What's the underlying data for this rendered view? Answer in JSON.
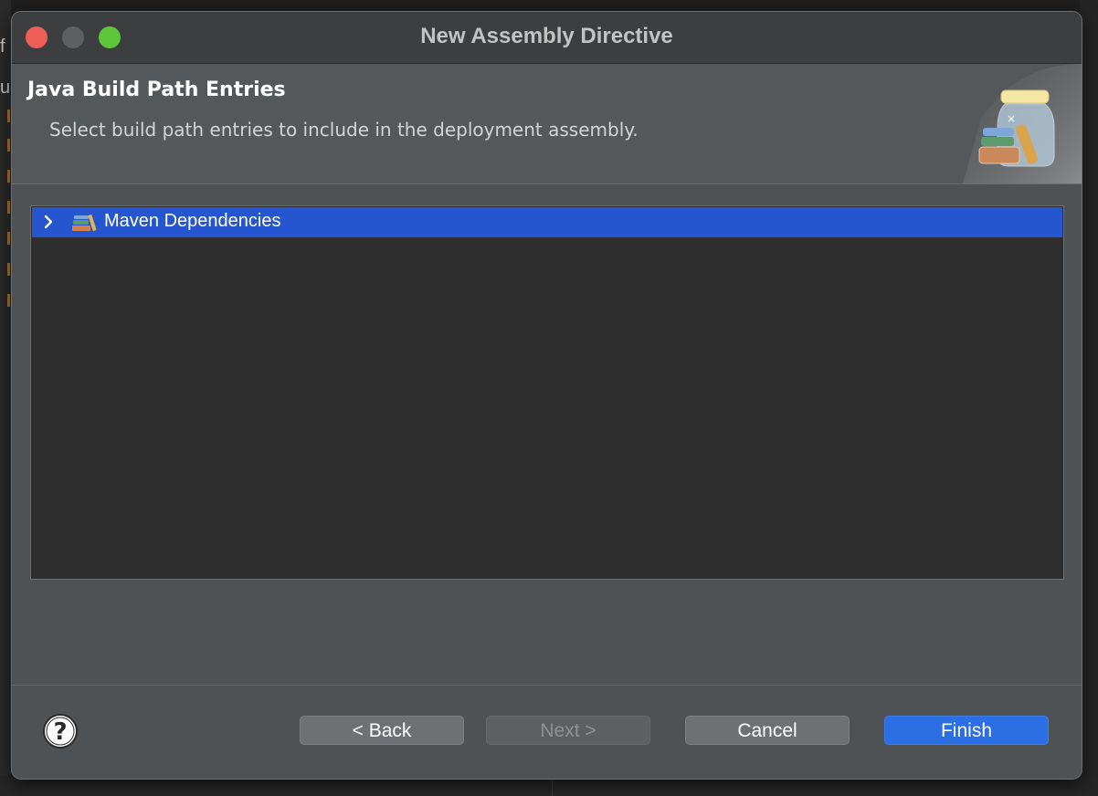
{
  "window": {
    "title": "New Assembly Directive"
  },
  "background": {
    "edge_chars": [
      "f",
      "u"
    ]
  },
  "header": {
    "title": "Java Build Path Entries",
    "description": "Select build path entries to include in the deployment assembly."
  },
  "tree": {
    "items": [
      {
        "label": "Maven Dependencies",
        "selected": true,
        "expanded": false,
        "icon": "library-books-icon"
      }
    ]
  },
  "buttons": {
    "back": "< Back",
    "next": "Next >",
    "cancel": "Cancel",
    "finish": "Finish"
  },
  "colors": {
    "selection": "#2556cf",
    "primary_button": "#2c6ee3",
    "close": "#ee5e56",
    "maximize": "#5ec63b"
  }
}
